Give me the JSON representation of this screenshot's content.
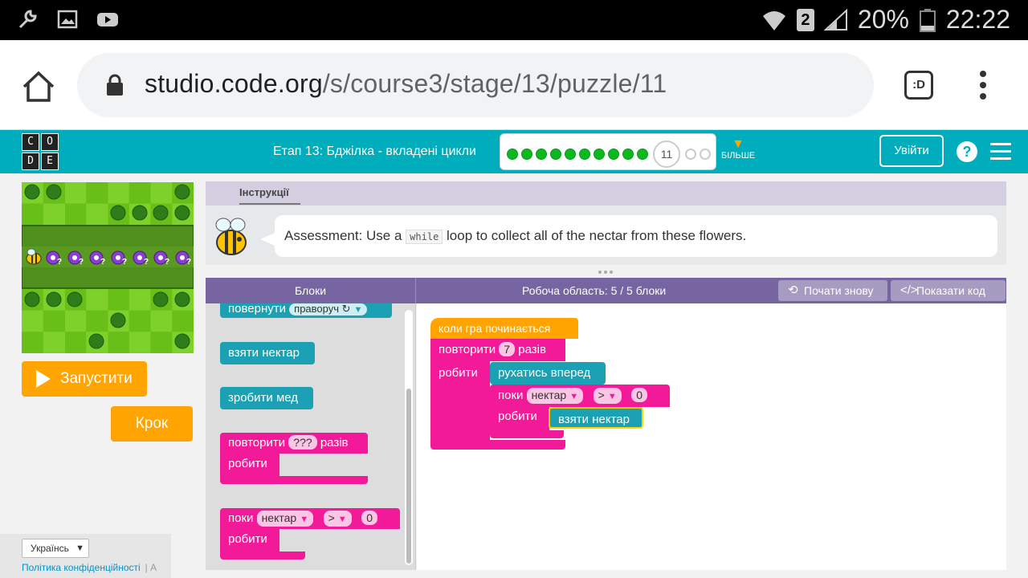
{
  "status_bar": {
    "battery": "20%",
    "time": "22:22",
    "sim": "2"
  },
  "browser": {
    "url_host": "studio.code.org",
    "url_path": "/s/course3/stage/13/puzzle/11",
    "tabs_label": ":D"
  },
  "header": {
    "logo_letters": [
      "C",
      "O",
      "D",
      "E"
    ],
    "stage_title": "Етап 13: Бджілка - вкладені цикли",
    "current_puzzle": "11",
    "completed_count": 10,
    "remaining_count": 2,
    "more_label": "БІЛЬШЕ",
    "signin_label": "Увійти",
    "help_label": "?"
  },
  "game": {
    "run_label": "Запустити",
    "step_label": "Крок"
  },
  "footer": {
    "language": "Українсь",
    "privacy_label": "Політика конфіденційності",
    "separator": "|",
    "cut_text": "А"
  },
  "instructions": {
    "tab_label": "Інструкції",
    "text_before": "Assessment: Use a ",
    "code_word": "while",
    "text_after": " loop to collect all of the nectar from these flowers."
  },
  "workspace_header": {
    "toolbox_title": "Блоки",
    "area_title": "Робоча область: 5 / 5 блоки",
    "restart_label": "Почати знову",
    "show_code_label": "Показати код"
  },
  "toolbox": {
    "turn_label": "повернути",
    "turn_dir": "праворуч ↻",
    "get_nectar": "взяти нектар",
    "make_honey": "зробити мед",
    "repeat_label": "повторити",
    "repeat_value": "???",
    "repeat_times": "разів",
    "do_label": "робити",
    "while_label": "поки",
    "nectar_option": "нектар",
    "compare_option": ">",
    "compare_value": "0"
  },
  "program": {
    "when_run": "коли гра починається",
    "repeat_label": "повторити",
    "repeat_value": "7",
    "repeat_times": "разів",
    "do_label": "робити",
    "move_forward": "рухатись вперед",
    "while_label": "поки",
    "nectar_option": "нектар",
    "compare_option": ">",
    "compare_value": "0",
    "do_label_inner": "робити",
    "get_nectar": "взяти нектар"
  }
}
